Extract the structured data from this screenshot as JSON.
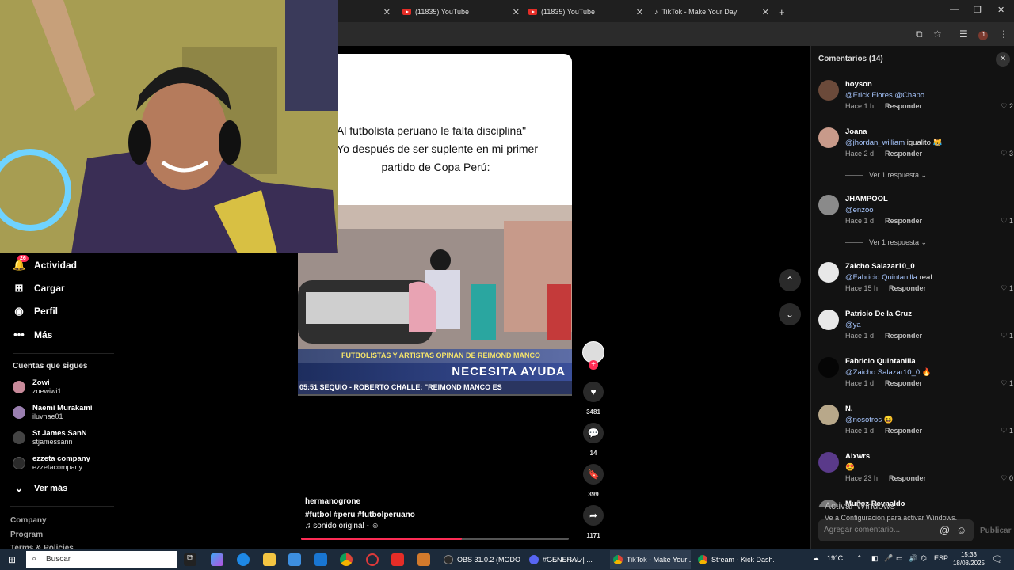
{
  "browser": {
    "tabs": [
      {
        "label": "(11835) YouTube"
      },
      {
        "label": "(11835) YouTube"
      },
      {
        "label": "TikTok - Make Your Day"
      }
    ],
    "new_tab": "+",
    "profile_initial": "J"
  },
  "sidebar": {
    "badge": "26",
    "items": [
      {
        "label": "Actividad",
        "icon": "bell-icon"
      },
      {
        "label": "Cargar",
        "icon": "upload-icon"
      },
      {
        "label": "Perfil",
        "icon": "profile-icon"
      },
      {
        "label": "Más",
        "icon": "more-icon"
      }
    ],
    "following_title": "Cuentas que sigues",
    "following": [
      {
        "name": "Zowi",
        "handle": "zoewiwi1",
        "color": "#c88a9a"
      },
      {
        "name": "Naemi Murakami",
        "handle": "iluvnae01",
        "color": "#9a7fb0"
      },
      {
        "name": "St James SanN",
        "handle": "stjamessann",
        "color": "#444"
      },
      {
        "name": "ezzeta company",
        "handle": "ezzetacompany",
        "color": "#2b2b2b"
      }
    ],
    "see_more": "Ver más",
    "footer": [
      "Company",
      "Program",
      "Terms & Policies"
    ]
  },
  "video": {
    "caption_lines": [
      "\"Al futbolista peruano le falta disciplina\"",
      "Yo después de ser suplente en mi primer",
      "partido de Copa Perú:"
    ],
    "ticker_top": "FUTBOLISTAS Y ARTISTAS OPINAN DE REIMOND MANCO",
    "ticker_main": "NECESITA AYUDA",
    "ticker_bottom": "05:51   SEQUIO   -   ROBERTO CHALLE: \"REIMOND MANCO ES",
    "author": "hermanogrone",
    "hashtags": "#futbol  #peru  #futbolperuano",
    "sound": "♫  sonido original - ☺",
    "progress": 0.6
  },
  "actions": {
    "likes": "3481",
    "comments": "14",
    "saves": "399",
    "shares": "1171"
  },
  "comments": {
    "title": "Comentarios (14)",
    "items": [
      {
        "user": "hoyson",
        "mention": "@Erick Flores @Chapo",
        "text": "",
        "time": "Hace 1 h",
        "reply": "Responder",
        "likes": "2",
        "color": "#6b4a3a"
      },
      {
        "user": "Joana",
        "mention": "@jhordan_william",
        "text": " igualito 😹",
        "time": "Hace 2 d",
        "reply": "Responder",
        "likes": "3",
        "color": "#c89a8a",
        "view_replies": "Ver 1 respuesta ⌄"
      },
      {
        "user": "JHAMPOOL",
        "mention": "@enzoo",
        "text": "",
        "time": "Hace 1 d",
        "reply": "Responder",
        "likes": "1",
        "color": "#8a8a8a",
        "view_replies": "Ver 1 respuesta ⌄"
      },
      {
        "user": "Zaicho Salazar10_0",
        "mention": "@Fabricio Quintanilla",
        "text": " real",
        "time": "Hace 15 h",
        "reply": "Responder",
        "likes": "1",
        "color": "#e8e8e8"
      },
      {
        "user": "Patricio De la Cruz",
        "mention": "@ya",
        "text": "",
        "time": "Hace 1 d",
        "reply": "Responder",
        "likes": "1",
        "color": "#e8e8e8"
      },
      {
        "user": "Fabricio Quintanilla",
        "mention": "@Zaicho Salazar10_0",
        "text": " 🔥",
        "time": "Hace 1 d",
        "reply": "Responder",
        "likes": "1",
        "color": "#050505"
      },
      {
        "user": "N.",
        "mention": "@nosotros",
        "text": " 😆",
        "time": "Hace 1 d",
        "reply": "Responder",
        "likes": "1",
        "color": "#b8a88a"
      },
      {
        "user": "Alxwrs",
        "mention": "",
        "text": "😍",
        "time": "Hace 23 h",
        "reply": "Responder",
        "likes": "0",
        "color": "#5a3a8a"
      },
      {
        "user": "Muñoz Reynaldo",
        "mention": "",
        "text": "",
        "time": "",
        "reply": "",
        "likes": "",
        "color": "#777"
      }
    ],
    "input_placeholder": "Agregar comentario...",
    "publish": "Publicar"
  },
  "windows_activation": {
    "title": "Activar Windows",
    "subtitle": "Ve a Configuración para activar Windows."
  },
  "taskbar": {
    "search_placeholder": "Buscar",
    "tasks": [
      {
        "label": "OBS 31.0.2 (MODO ...",
        "color": "#2a2a2a"
      },
      {
        "label": "#G̷E̷N̷E̷R̷A̷L̷ | ...",
        "color": "#5865f2"
      },
      {
        "label": "TikTok - Make Your ...",
        "color": "#4285f4"
      },
      {
        "label": "Stream - Kick Dash...",
        "color": "#4285f4"
      }
    ],
    "weather": "19°C",
    "lang": "ESP",
    "time": "15:33",
    "date": "18/08/2025"
  }
}
